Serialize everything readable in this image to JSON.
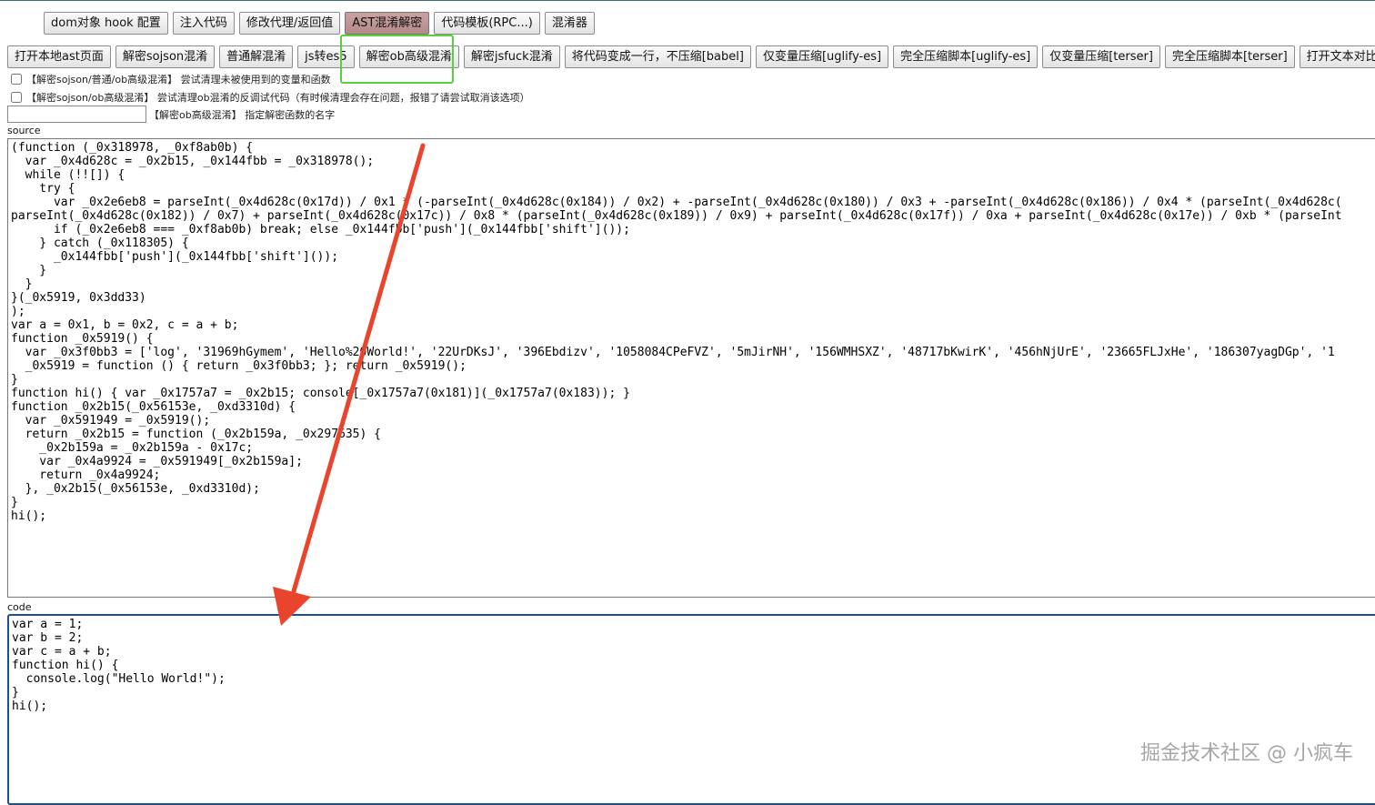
{
  "toolbar_top": [
    {
      "label": "dom对象 hook 配置",
      "active": false
    },
    {
      "label": "注入代码",
      "active": false
    },
    {
      "label": "修改代理/返回值",
      "active": false
    },
    {
      "label": "AST混淆解密",
      "active": true
    },
    {
      "label": "代码模板(RPC...)",
      "active": false
    },
    {
      "label": "混淆器",
      "active": false
    }
  ],
  "toolbar_main": [
    {
      "label": "打开本地ast页面"
    },
    {
      "label": "解密sojson混淆"
    },
    {
      "label": "普通解混淆"
    },
    {
      "label": "js转es5"
    },
    {
      "label": "解密ob高级混淆"
    },
    {
      "label": "解密jsfuck混淆"
    },
    {
      "label": "将代码变成一行，不压缩[babel]"
    },
    {
      "label": "仅变量压缩[uglify-es]"
    },
    {
      "label": "完全压缩脚本[uglify-es]"
    },
    {
      "label": "仅变量压缩[terser]"
    },
    {
      "label": "完全压缩脚本[terser]"
    },
    {
      "label": "打开文本对比工具"
    }
  ],
  "options": {
    "opt1": "【解密sojson/普通/ob高级混淆】 尝试清理未被使用到的变量和函数",
    "opt2": "【解密sojson/ob高级混淆】 尝试清理ob混淆的反调试代码（有时候清理会存在问题，报错了请尝试取消该选项）",
    "decrypt_fn_value": "",
    "decrypt_fn_label": "【解密ob高级混淆】 指定解密函数的名字"
  },
  "source": {
    "label": "source",
    "text": "(function (_0x318978, _0xf8ab0b) {\n  var _0x4d628c = _0x2b15, _0x144fbb = _0x318978();\n  while (!![]) {\n    try {\n      var _0x2e6eb8 = parseInt(_0x4d628c(0x17d)) / 0x1 * (-parseInt(_0x4d628c(0x184)) / 0x2) + -parseInt(_0x4d628c(0x180)) / 0x3 + -parseInt(_0x4d628c(0x186)) / 0x4 * (parseInt(_0x4d628c(\nparseInt(_0x4d628c(0x182)) / 0x7) + parseInt(_0x4d628c(0x17c)) / 0x8 * (parseInt(_0x4d628c(0x189)) / 0x9) + parseInt(_0x4d628c(0x17f)) / 0xa + parseInt(_0x4d628c(0x17e)) / 0xb * (parseInt\n      if (_0x2e6eb8 === _0xf8ab0b) break; else _0x144fbb['push'](_0x144fbb['shift']());\n    } catch (_0x118305) {\n      _0x144fbb['push'](_0x144fbb['shift']());\n    }\n  }\n}(_0x5919, 0x3dd33)\n);\nvar a = 0x1, b = 0x2, c = a + b;\nfunction _0x5919() {\n  var _0x3f0bb3 = ['log', '31969hGymem', 'Hello%20World!', '22UrDKsJ', '396Ebdizv', '1058084CPeFVZ', '5mJirNH', '156WMHSXZ', '48717bKwirK', '456hNjUrE', '23665FLJxHe', '186307yagDGp', '1\n  _0x5919 = function () { return _0x3f0bb3; }; return _0x5919();\n}\nfunction hi() { var _0x1757a7 = _0x2b15; console[_0x1757a7(0x181)](_0x1757a7(0x183)); }\nfunction _0x2b15(_0x56153e, _0xd3310d) {\n  var _0x591949 = _0x5919();\n  return _0x2b15 = function (_0x2b159a, _0x297635) {\n    _0x2b159a = _0x2b159a - 0x17c;\n    var _0x4a9924 = _0x591949[_0x2b159a];\n    return _0x4a9924;\n  }, _0x2b15(_0x56153e, _0xd3310d);\n}\nhi();"
  },
  "code": {
    "label": "code",
    "text": "var a = 1;\nvar b = 2;\nvar c = a + b;\nfunction hi() {\n  console.log(\"Hello World!\");\n}\nhi();"
  },
  "annotation": {
    "highlight_color": "#5bd03d",
    "arrow_color": "#e8452c"
  },
  "watermark": "掘金技术社区 @ 小疯车"
}
